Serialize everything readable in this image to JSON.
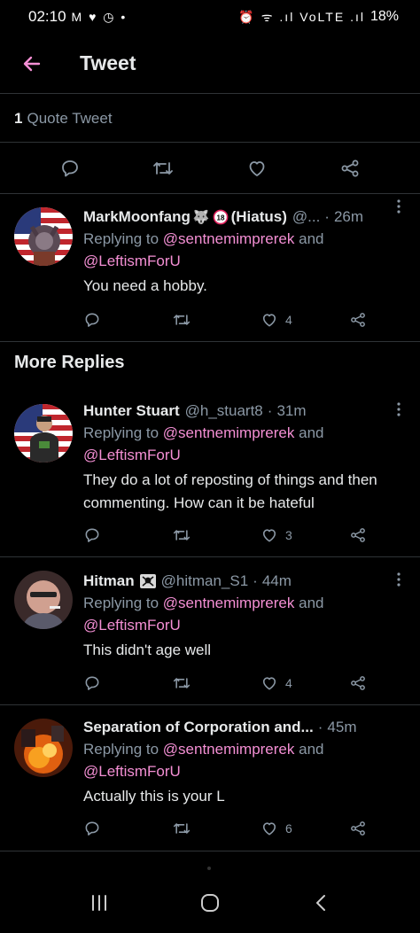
{
  "status_bar": {
    "time": "02:10",
    "left_icons": "M ♥ ◷ •",
    "right_icons": "⏰ ᯤ .ıl VoLTE .ıl",
    "battery": "18%"
  },
  "header": {
    "title": "Tweet"
  },
  "quote": {
    "count": "1",
    "label": "Quote Tweet"
  },
  "tweets": [
    {
      "name": "MarkMoonfang",
      "name_suffix": "(Hiatus)",
      "handle": "@...",
      "time": "26m",
      "replying_prefix": "Replying to",
      "mention_1": "@sentnemimprerek",
      "and": "and",
      "mention_2": "@LeftismForU",
      "text": "You need a hobby.",
      "likes": "4"
    },
    {
      "name": "Hunter Stuart",
      "handle": "@h_stuart8",
      "time": "31m",
      "replying_prefix": "Replying to",
      "mention_1": "@sentnemimprerek",
      "and": "and",
      "mention_2": "@LeftismForU",
      "text": "They do a lot of reposting of things and then commenting. How can it be hateful",
      "likes": "3"
    },
    {
      "name": "Hitman",
      "handle": "@hitman_S1",
      "time": "44m",
      "replying_prefix": "Replying to",
      "mention_1": "@sentnemimprerek",
      "and": "and",
      "mention_2": "@LeftismForU",
      "text": "This didn't age well",
      "likes": "4"
    },
    {
      "name": "Separation of Corporation and...",
      "handle": "",
      "time": "45m",
      "replying_prefix": "Replying to",
      "mention_1": "@sentnemimprerek",
      "and": "and",
      "mention_2": "@LeftismForU",
      "text": "Actually this is your L",
      "likes": "6"
    }
  ],
  "section": {
    "more_replies": "More Replies"
  },
  "colors": {
    "accent": "#f48fd4",
    "muted": "#8b98a5",
    "divider": "#2f3336"
  }
}
